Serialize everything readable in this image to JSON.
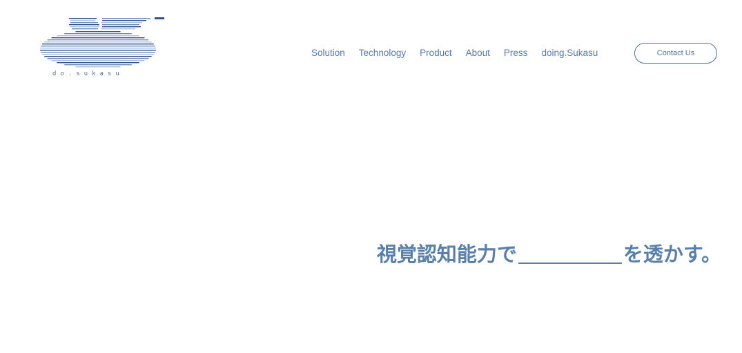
{
  "brand": {
    "logo_text": "do.sukasu",
    "logo_icon": "striped-ds-logo-icon"
  },
  "nav": {
    "items": [
      {
        "label": "Solution"
      },
      {
        "label": "Technology"
      },
      {
        "label": "Product"
      },
      {
        "label": "About"
      },
      {
        "label": "Press"
      },
      {
        "label": "doing.Sukasu"
      }
    ],
    "contact_label": "Contact Us"
  },
  "hero": {
    "headline_before": "視覚認知能力で",
    "headline_after": "を透かす。"
  },
  "colors": {
    "accent": "#5a7fa8",
    "logo_dark": "#34508a",
    "logo_light": "#a9bfe0"
  }
}
